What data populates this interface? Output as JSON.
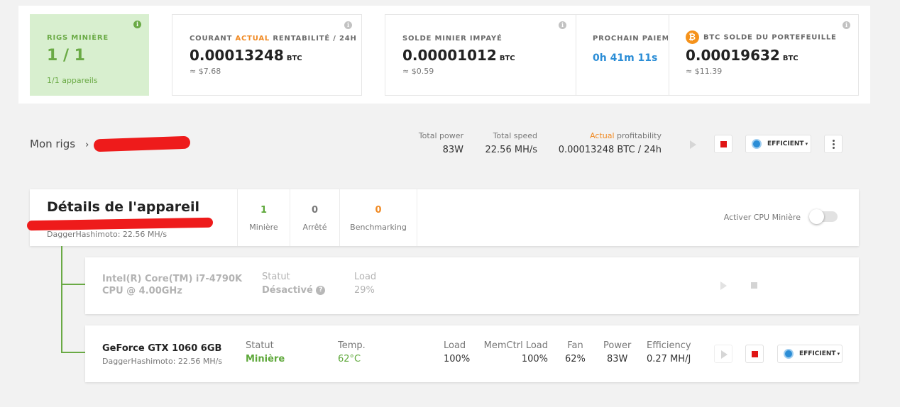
{
  "stats": {
    "rigs": {
      "label": "RIGS MINIÈRE",
      "value": "1 / 1",
      "sub": "1/1 appareils"
    },
    "profitability": {
      "label_pre": "COURANT ",
      "label_actual": "ACTUAL",
      "label_post": " RENTABILITÉ / 24H",
      "value": "0.00013248",
      "unit": "BTC",
      "usd": "≈ $7.68"
    },
    "unpaid": {
      "label": "SOLDE MINIER IMPAYÉ",
      "value": "0.00001012",
      "unit": "BTC",
      "usd": "≈ $0.59"
    },
    "next_payout": {
      "label": "PROCHAIN PAIEMENT",
      "value": "0h 41m 11s"
    },
    "wallet": {
      "label": "BTC SOLDE DU PORTEFEUILLE",
      "value": "0.00019632",
      "unit": "BTC",
      "usd": "≈ $11.39"
    }
  },
  "rig": {
    "breadcrumb": "Mon rigs",
    "total_power_label": "Total power",
    "total_power": "83W",
    "total_speed_label": "Total speed",
    "total_speed": "22.56 MH/s",
    "profit_label_actual": "Actual",
    "profit_label_rest": " profitability",
    "profitability": "0.00013248 BTC / 24h",
    "mode": "EFFICIENT"
  },
  "details": {
    "title": "Détails de l'appareil",
    "algo": "DaggerHashimoto: 22.56 MH/s",
    "mining_count": "1",
    "mining_label": "Minière",
    "stopped_count": "0",
    "stopped_label": "Arrêté",
    "bench_count": "0",
    "bench_label": "Benchmarking",
    "cpu_toggle_label": "Activer CPU Minière"
  },
  "cpu": {
    "name_line1": "Intel(R) Core(TM) i7-4790K",
    "name_line2": "CPU @ 4.00GHz",
    "status_label": "Statut",
    "status": "Désactivé",
    "load_label": "Load",
    "load": "29%"
  },
  "gpu": {
    "name": "GeForce GTX 1060 6GB",
    "algo": "DaggerHashimoto: 22.56 MH/s",
    "status_label": "Statut",
    "status": "Minière",
    "temp_label": "Temp.",
    "temp": "62°C",
    "load_label": "Load",
    "load": "100%",
    "memctrl_label": "MemCtrl Load",
    "memctrl": "100%",
    "fan_label": "Fan",
    "fan": "62%",
    "power_label": "Power",
    "power": "83W",
    "eff_label": "Efficiency",
    "eff": "0.27 MH/J",
    "mode": "EFFICIENT"
  },
  "icons": {
    "info": "info-icon",
    "bitcoin": "bitcoin-icon",
    "play": "play-icon",
    "stop": "stop-icon",
    "more": "more-vertical-icon",
    "mode": "efficient-mode-icon",
    "help": "question-icon"
  },
  "colors": {
    "green": "#6aaa45",
    "orange": "#f08a24",
    "blue": "#2b8dd6",
    "red": "#e01616"
  }
}
